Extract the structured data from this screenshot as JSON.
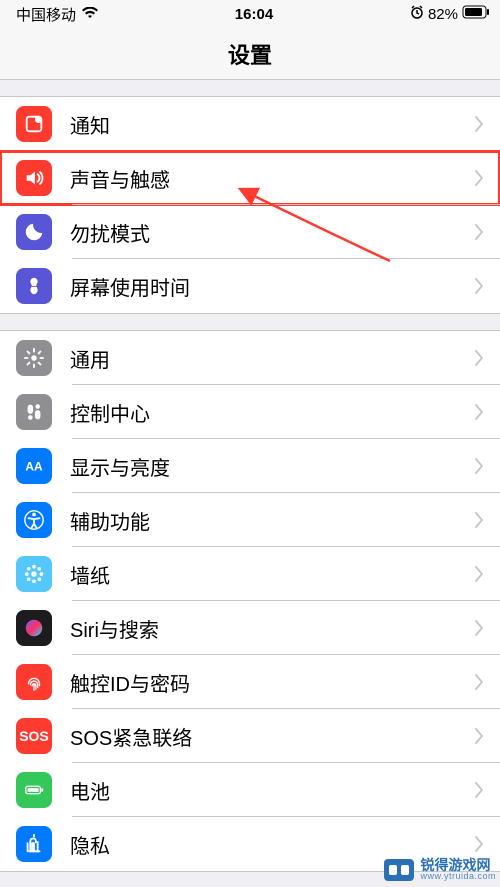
{
  "status": {
    "carrier": "中国移动",
    "time": "16:04",
    "battery": "82%"
  },
  "title": "设置",
  "groups": [
    {
      "rows": [
        {
          "icon": "notifications-icon",
          "bg": "bg-red",
          "label": "通知",
          "highlighted": false
        },
        {
          "icon": "sounds-icon",
          "bg": "bg-red",
          "label": "声音与触感",
          "highlighted": true
        },
        {
          "icon": "dnd-icon",
          "bg": "bg-purple",
          "label": "勿扰模式",
          "highlighted": false
        },
        {
          "icon": "screentime-icon",
          "bg": "bg-purple",
          "label": "屏幕使用时间",
          "highlighted": false
        }
      ]
    },
    {
      "rows": [
        {
          "icon": "general-icon",
          "bg": "bg-grey",
          "label": "通用",
          "highlighted": false
        },
        {
          "icon": "control-center-icon",
          "bg": "bg-grey",
          "label": "控制中心",
          "highlighted": false
        },
        {
          "icon": "display-icon",
          "bg": "bg-blue",
          "label": "显示与亮度",
          "highlighted": false
        },
        {
          "icon": "accessibility-icon",
          "bg": "bg-blue",
          "label": "辅助功能",
          "highlighted": false
        },
        {
          "icon": "wallpaper-icon",
          "bg": "bg-cyan",
          "label": "墙纸",
          "highlighted": false
        },
        {
          "icon": "siri-icon",
          "bg": "bg-black",
          "label": "Siri与搜索",
          "highlighted": false
        },
        {
          "icon": "touchid-icon",
          "bg": "bg-red",
          "label": "触控ID与密码",
          "highlighted": false
        },
        {
          "icon": "sos-icon",
          "bg": "bg-sos",
          "label": "SOS紧急联络",
          "highlighted": false
        },
        {
          "icon": "battery-icon",
          "bg": "bg-green",
          "label": "电池",
          "highlighted": false
        },
        {
          "icon": "privacy-icon",
          "bg": "bg-hand",
          "label": "隐私",
          "highlighted": false
        }
      ]
    }
  ],
  "watermark": {
    "cn": "锐得游戏网",
    "en": "www.ytruida.com"
  }
}
